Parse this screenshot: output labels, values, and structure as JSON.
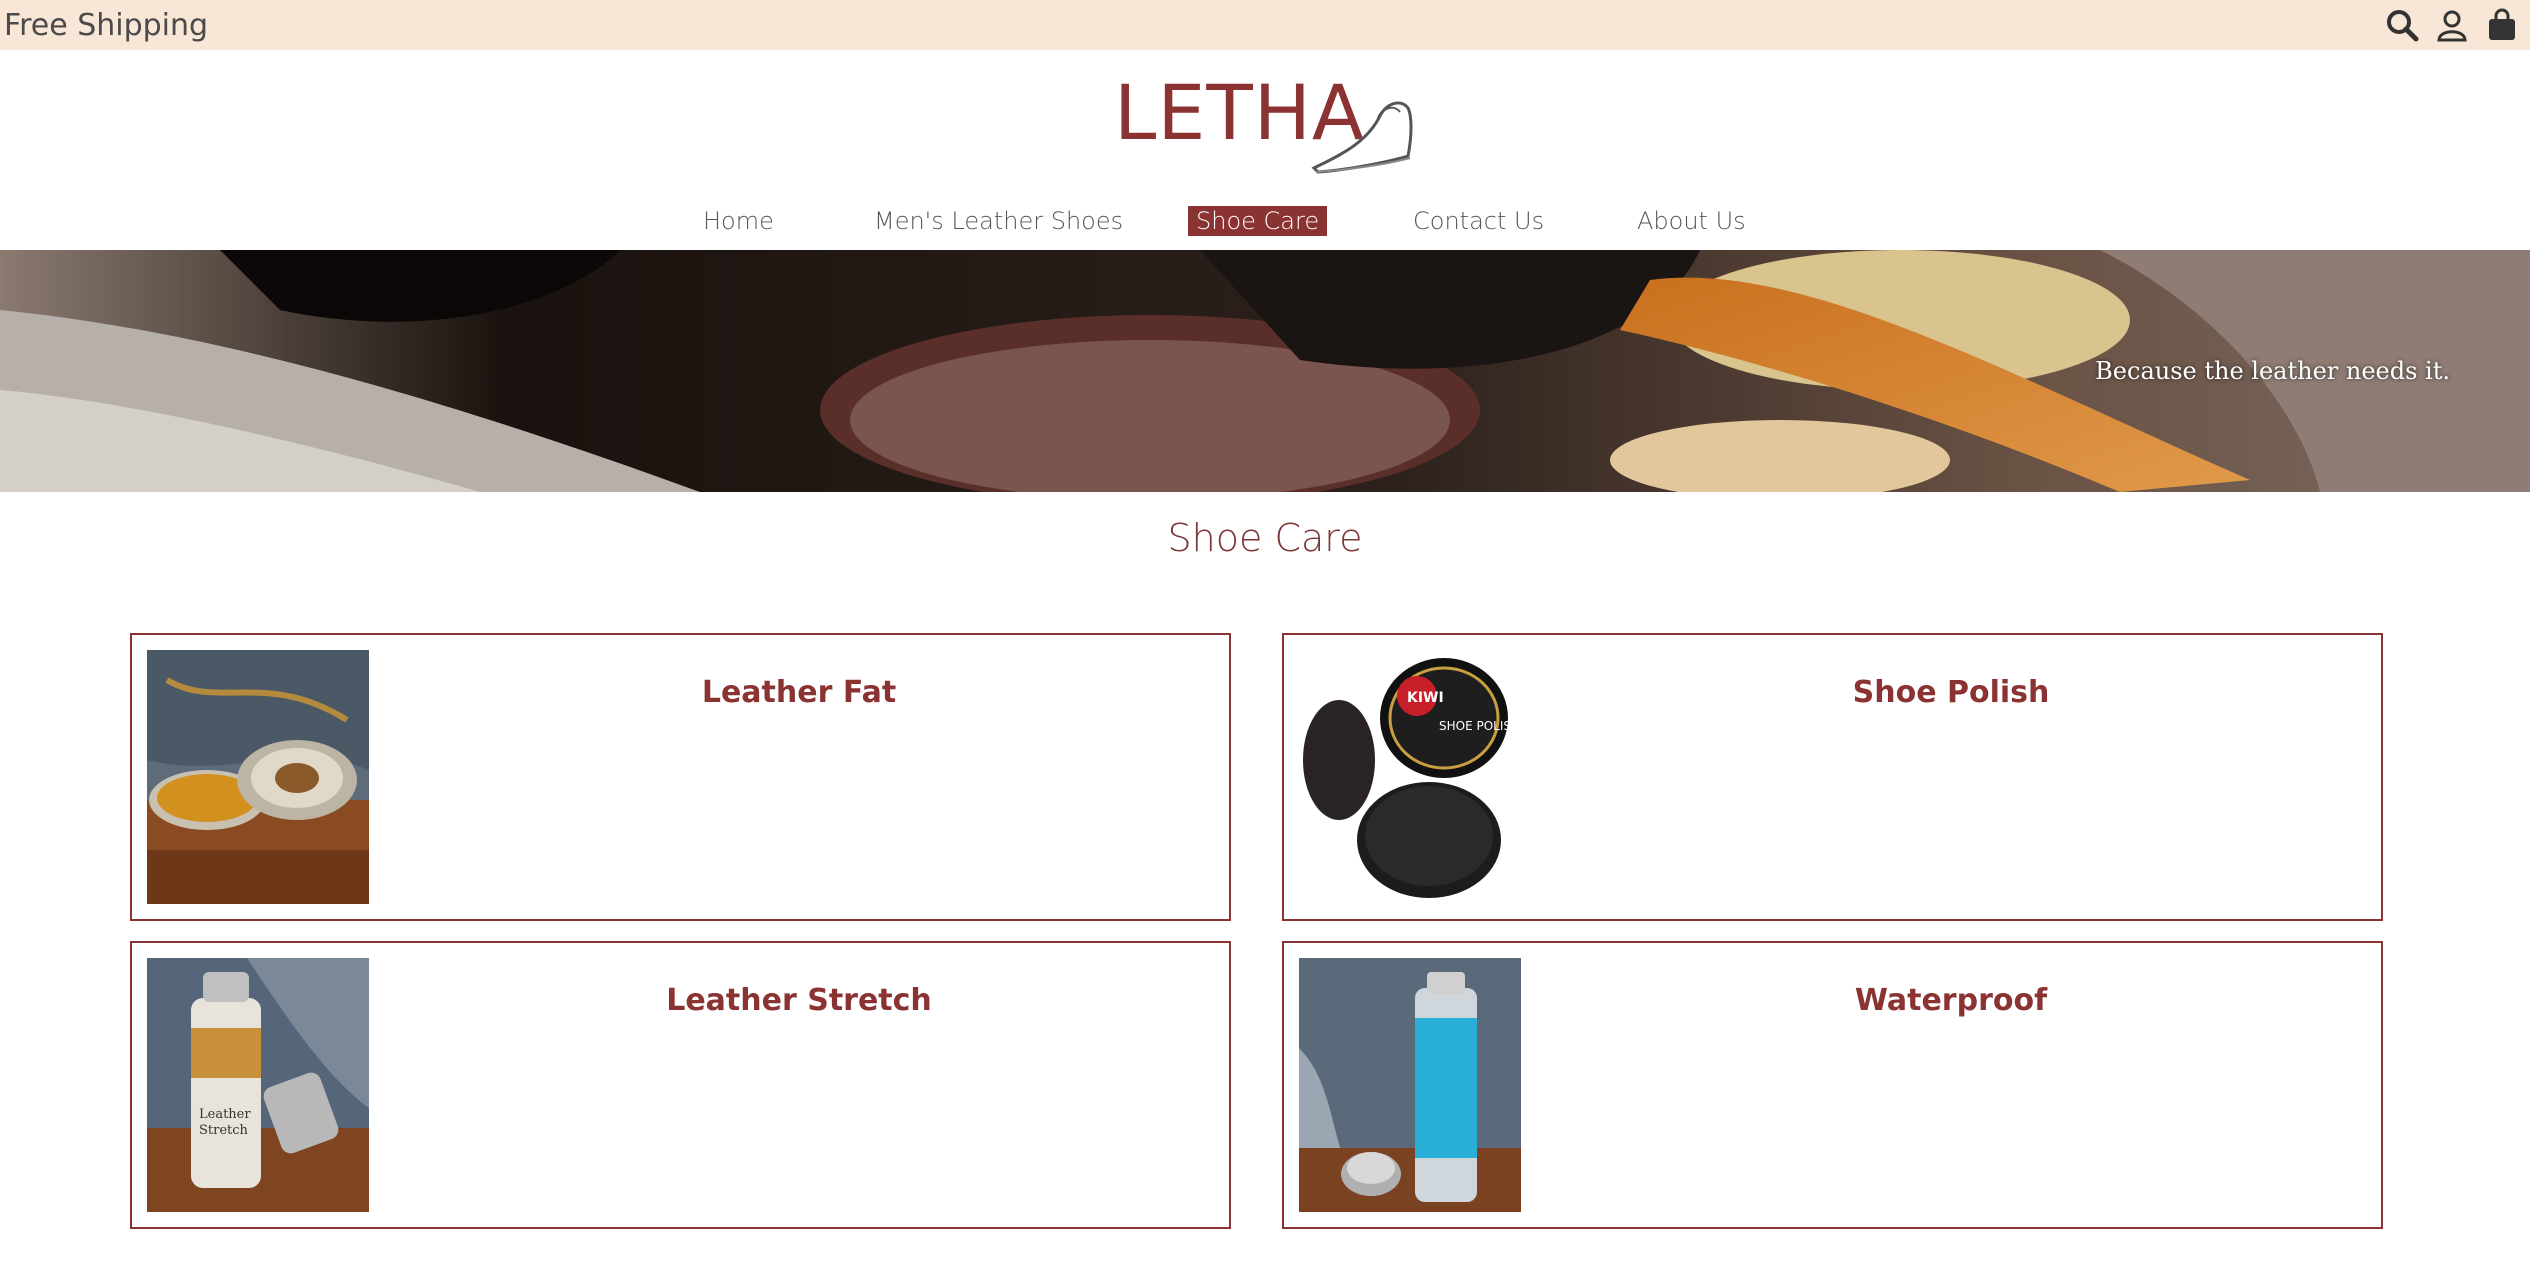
{
  "topbar": {
    "shipping": "Free Shipping",
    "icons": [
      "search-icon",
      "user-icon",
      "shopping-bag-icon"
    ]
  },
  "brand": {
    "name": "LETHA"
  },
  "nav": {
    "items": [
      {
        "label": "Home"
      },
      {
        "label": "Men's Leather Shoes"
      },
      {
        "label": "Shoe Care",
        "active": true
      },
      {
        "label": "Contact Us"
      },
      {
        "label": "About Us"
      }
    ]
  },
  "hero": {
    "tagline": "Because the leather needs it."
  },
  "page": {
    "title": "Shoe Care"
  },
  "products": [
    {
      "title": "Leather Fat"
    },
    {
      "title": "Shoe Polish"
    },
    {
      "title": "Leather Stretch"
    },
    {
      "title": "Waterproof"
    }
  ],
  "colors": {
    "accent": "#8b3232",
    "topbar_bg": "#f8e6d6"
  }
}
